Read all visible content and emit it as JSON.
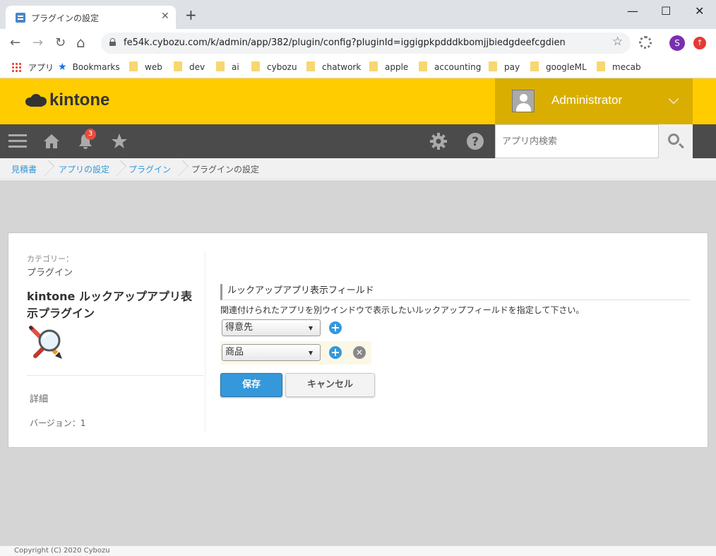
{
  "browser": {
    "tab_title": "プラグインの設定",
    "tab_close": "✕",
    "new_tab": "+",
    "url": "fe54k.cybozu.com/k/admin/app/382/plugin/config?pluginId=iggigpkpdddkbomjjbiedgdeefcgdien",
    "profile_initial": "S",
    "window": {
      "minimize": "—",
      "maximize": "☐",
      "close": "✕"
    },
    "nav": {
      "back": "←",
      "forward": "→",
      "reload": "↻",
      "home": "⌂"
    },
    "bookmark_star": "☆",
    "bookmarks": [
      {
        "label": "アプリ",
        "icon": "apps-grid-icon"
      },
      {
        "label": "Bookmarks",
        "icon": "star-icon"
      },
      {
        "label": "web",
        "icon": "folder-icon"
      },
      {
        "label": "dev",
        "icon": "folder-icon"
      },
      {
        "label": "ai",
        "icon": "folder-icon"
      },
      {
        "label": "cybozu",
        "icon": "folder-icon"
      },
      {
        "label": "chatwork",
        "icon": "folder-icon"
      },
      {
        "label": "apple",
        "icon": "folder-icon"
      },
      {
        "label": "accounting",
        "icon": "folder-icon"
      },
      {
        "label": "pay",
        "icon": "folder-icon"
      },
      {
        "label": "googleML",
        "icon": "folder-icon"
      },
      {
        "label": "mecab",
        "icon": "folder-icon"
      }
    ]
  },
  "header": {
    "logo": "kintone",
    "username": "Administrator",
    "notification_count": "3",
    "search_placeholder": "アプリ内検索"
  },
  "breadcrumb": [
    "見積書",
    "アプリの設定",
    "プラグイン",
    "プラグインの設定"
  ],
  "sidebar": {
    "category_label": "カテゴリー：",
    "category_value": "プラグイン",
    "plugin_name": "kintone ルックアップアプリ表示プラグイン",
    "detail": "詳細",
    "version": "バージョン：1"
  },
  "config": {
    "section_title": "ルックアップアプリ表示フィールド",
    "description": "関連付けられたアプリを別ウインドウで表示したいルックアップフィールドを指定して下さい。",
    "fields": [
      "得意先",
      "商品"
    ],
    "add_symbol": "+",
    "remove_symbol": "✕",
    "save": "保存",
    "cancel": "キャンセル"
  },
  "footer": "Copyright (C) 2020 Cybozu",
  "colors": {
    "brand_yellow": "#ffcc00",
    "user_area": "#d9ae00",
    "nav_dark": "#4b4b4b",
    "primary_blue": "#3498db",
    "badge_red": "#e74c3c"
  }
}
